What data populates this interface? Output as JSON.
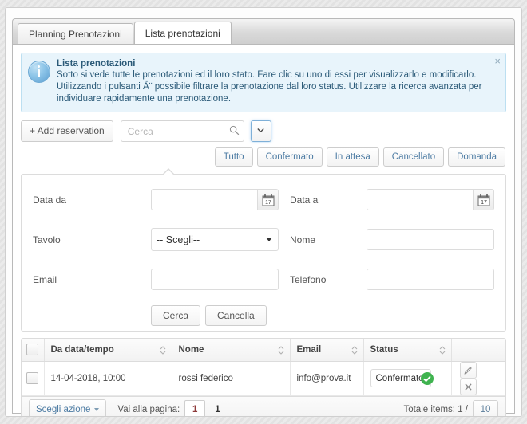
{
  "tabs": [
    {
      "label": "Planning Prenotazioni",
      "active": false
    },
    {
      "label": "Lista prenotazioni",
      "active": true
    }
  ],
  "alert": {
    "title": "Lista prenotazioni",
    "message": "Sotto si vede tutte le prenotazioni ed il loro stato. Fare clic su uno di essi per visualizzarlo e modificarlo. Utilizzando i pulsanti Ä¨ possibile filtrare la prenotazione dal loro status. Utilizzare la ricerca avanzata per individuare rapidamente una prenotazione.",
    "close_label": "×",
    "icon": "info-circle-icon",
    "bg_color": "#e8f4fb",
    "border_color": "#bcdff1",
    "text_color": "#2b5a78"
  },
  "toolbar": {
    "add_label": "+ Add reservation",
    "search_placeholder": "Cerca",
    "search_value": "",
    "search_icon": "magnifier-icon",
    "caret_icon": "chevron-down-icon"
  },
  "filters": [
    {
      "label": "Tutto"
    },
    {
      "label": "Confermato"
    },
    {
      "label": "In attesa"
    },
    {
      "label": "Cancellato"
    },
    {
      "label": "Domanda"
    }
  ],
  "search_panel": {
    "fields": {
      "data_da_label": "Data da",
      "data_da_value": "",
      "data_a_label": "Data a",
      "data_a_value": "",
      "tavolo_label": "Tavolo",
      "tavolo_selected": "-- Scegli--",
      "tavolo_options": [
        "-- Scegli--"
      ],
      "nome_label": "Nome",
      "nome_value": "",
      "email_label": "Email",
      "email_value": "",
      "telefono_label": "Telefono",
      "telefono_value": ""
    },
    "calendar_icon": "calendar-17-icon",
    "actions": {
      "search_label": "Cerca",
      "clear_label": "Cancella"
    }
  },
  "table": {
    "columns": [
      {
        "label": "Da data/tempo"
      },
      {
        "label": "Nome"
      },
      {
        "label": "Email"
      },
      {
        "label": "Status"
      }
    ],
    "sort_icon": "sort-updown-icon",
    "rows": [
      {
        "date": "14-04-2018, 10:00",
        "name": "rossi federico",
        "email": "info@prova.it",
        "status": "Confermato",
        "status_color": "#3fb34f",
        "edit_icon": "pencil-icon",
        "delete_icon": "close-icon"
      }
    ]
  },
  "footer": {
    "action_label": "Scegli azione",
    "goto_label": "Vai alla pagina:",
    "page_value": "1",
    "current_page": "1",
    "total_label": "Totale items: 1 /",
    "total_value": "10"
  }
}
